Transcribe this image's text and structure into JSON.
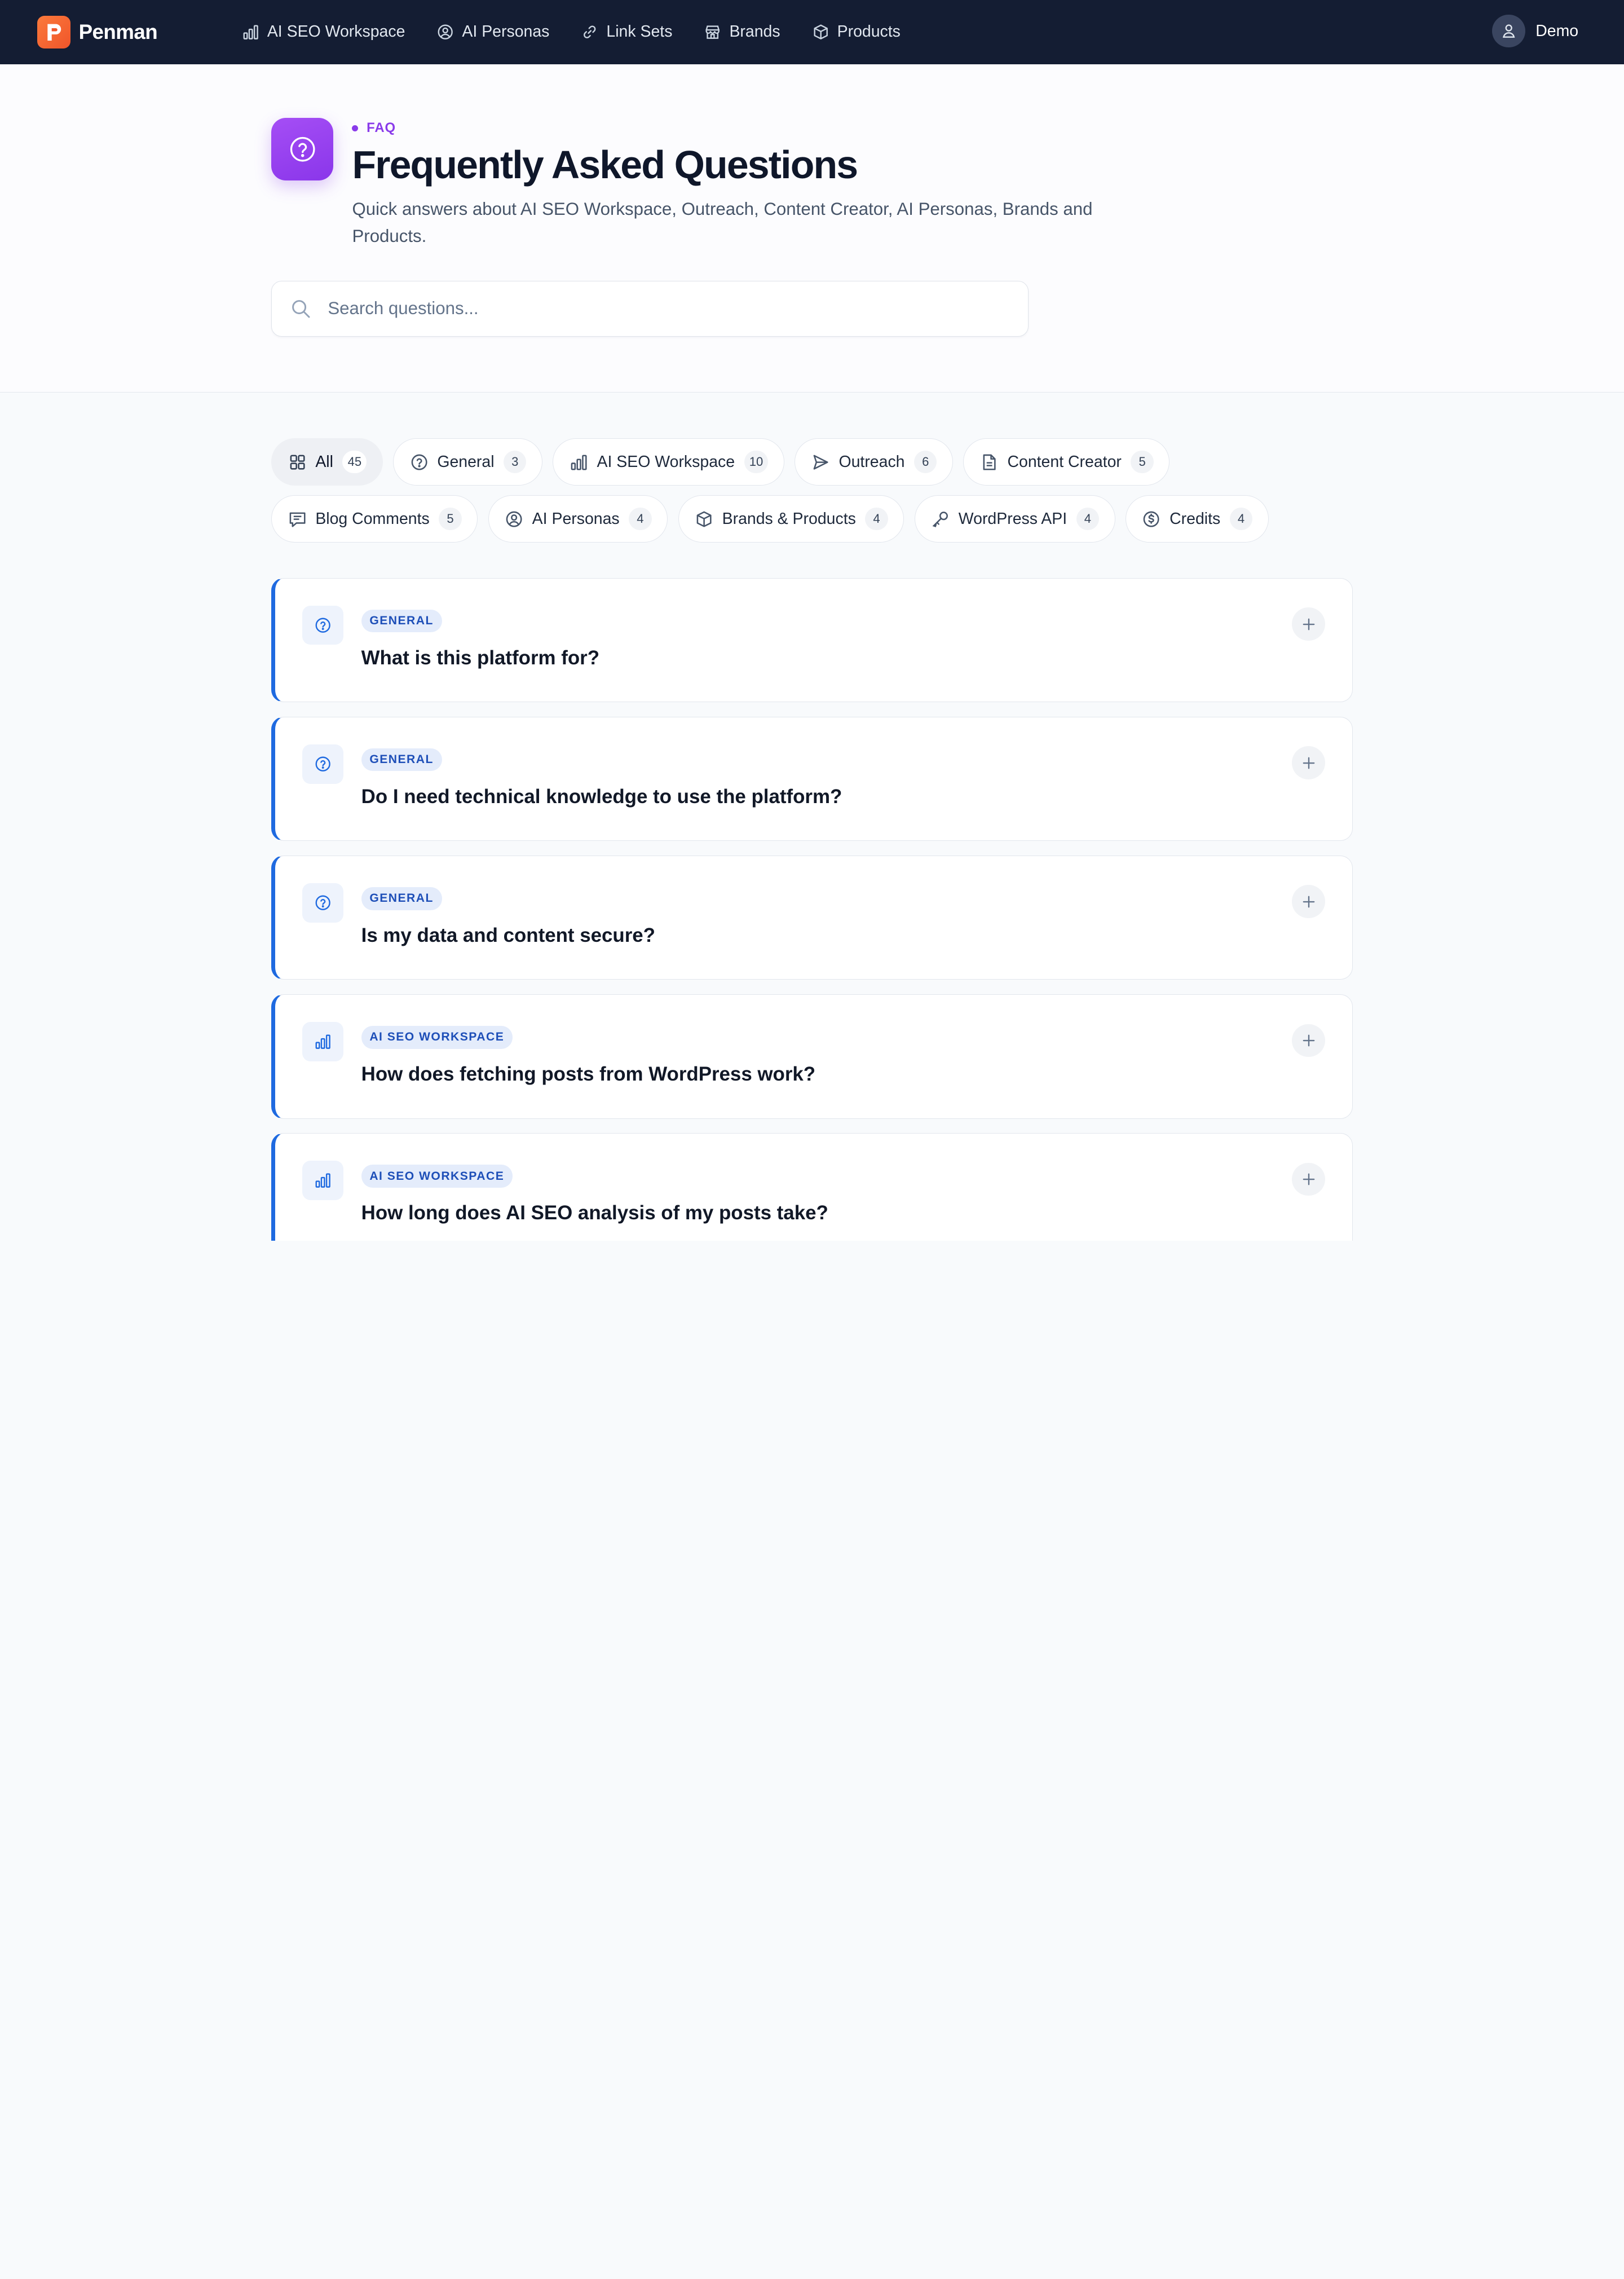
{
  "app": {
    "name": "Penman"
  },
  "nav": {
    "links": [
      {
        "label": "AI SEO Workspace",
        "icon": "bar-chart-icon"
      },
      {
        "label": "AI Personas",
        "icon": "user-circle-icon"
      },
      {
        "label": "Link Sets",
        "icon": "link-icon"
      },
      {
        "label": "Brands",
        "icon": "store-icon"
      },
      {
        "label": "Products",
        "icon": "box-icon"
      }
    ],
    "user": "Demo"
  },
  "hero": {
    "eyebrow": "FAQ",
    "title": "Frequently Asked Questions",
    "subtitle": "Quick answers about AI SEO Workspace, Outreach, Content Creator, AI Personas, Brands and Products.",
    "search_placeholder": "Search questions..."
  },
  "filters": [
    {
      "label": "All",
      "count": "45",
      "icon": "grid-icon",
      "active": true
    },
    {
      "label": "General",
      "count": "3",
      "icon": "help-circle-icon"
    },
    {
      "label": "AI SEO Workspace",
      "count": "10",
      "icon": "bar-chart-icon"
    },
    {
      "label": "Outreach",
      "count": "6",
      "icon": "send-icon"
    },
    {
      "label": "Content Creator",
      "count": "5",
      "icon": "document-icon"
    },
    {
      "label": "Blog Comments",
      "count": "5",
      "icon": "comment-icon"
    },
    {
      "label": "AI Personas",
      "count": "4",
      "icon": "user-circle-icon"
    },
    {
      "label": "Brands & Products",
      "count": "4",
      "icon": "box-icon"
    },
    {
      "label": "WordPress API",
      "count": "4",
      "icon": "key-icon"
    },
    {
      "label": "Credits",
      "count": "4",
      "icon": "dollar-circle-icon"
    }
  ],
  "faqs": [
    {
      "category": "GENERAL",
      "question": "What is this platform for?",
      "icon": "help-circle-icon"
    },
    {
      "category": "GENERAL",
      "question": "Do I need technical knowledge to use the platform?",
      "icon": "help-circle-icon"
    },
    {
      "category": "GENERAL",
      "question": "Is my data and content secure?",
      "icon": "help-circle-icon"
    },
    {
      "category": "AI SEO WORKSPACE",
      "question": "How does fetching posts from WordPress work?",
      "icon": "bar-chart-icon"
    },
    {
      "category": "AI SEO WORKSPACE",
      "question": "How long does AI SEO analysis of my posts take?",
      "icon": "bar-chart-icon"
    }
  ],
  "colors": {
    "nav_bg": "#141d33",
    "brand_orange": "#f0552a",
    "accent_purple": "#8a3bea",
    "faq_accent_blue": "#1f6ae0",
    "badge_bg": "#e4ecfb",
    "badge_text": "#1e4fb8"
  }
}
